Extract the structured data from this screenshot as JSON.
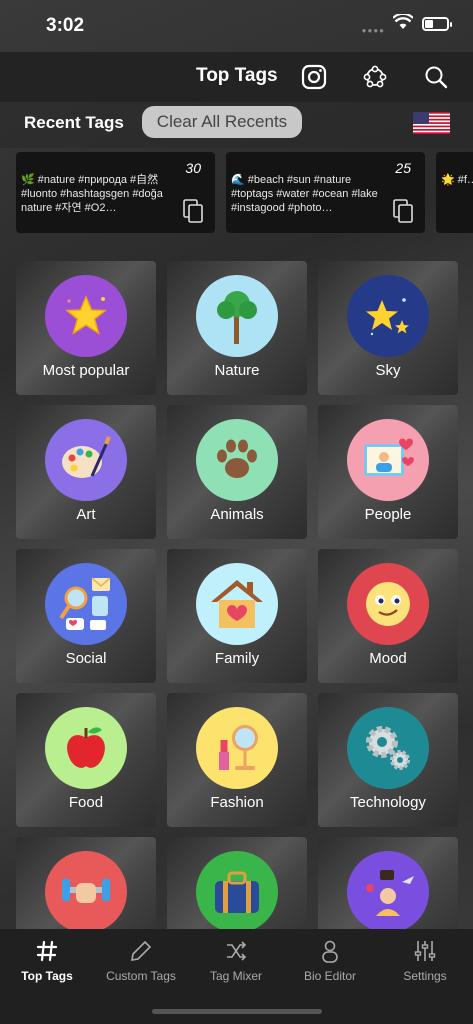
{
  "status": {
    "time": "3:02"
  },
  "header": {
    "title": "Top Tags"
  },
  "recent": {
    "label": "Recent Tags",
    "clear_label": "Clear All Recents",
    "cards": [
      {
        "count": "30",
        "text": "🌿 #nature #природа #自然 #luonto #hashtagsgen #doğa nature #자연 #O2…"
      },
      {
        "count": "25",
        "text": "🌊 #beach #sun #nature #toptags #water #ocean #lake #instagood #photo…"
      },
      {
        "count": "",
        "text": "🌟 #f… #webs… #food…"
      }
    ]
  },
  "categories": [
    {
      "label": "Most popular",
      "color": "#9b4fd6",
      "icon": "star-sparkle-icon"
    },
    {
      "label": "Nature",
      "color": "#aee3f5",
      "icon": "tree-icon"
    },
    {
      "label": "Sky",
      "color": "#263a8a",
      "icon": "stars-night-icon"
    },
    {
      "label": "Art",
      "color": "#8b6fe6",
      "icon": "palette-icon"
    },
    {
      "label": "Animals",
      "color": "#8fe0b4",
      "icon": "paw-icon"
    },
    {
      "label": "People",
      "color": "#f4a0b0",
      "icon": "portrait-heart-icon"
    },
    {
      "label": "Social",
      "color": "#5b74e6",
      "icon": "social-media-icon"
    },
    {
      "label": "Family",
      "color": "#bff0fb",
      "icon": "house-heart-icon"
    },
    {
      "label": "Mood",
      "color": "#e04650",
      "icon": "smiley-face-icon"
    },
    {
      "label": "Food",
      "color": "#b9ef8e",
      "icon": "apple-icon"
    },
    {
      "label": "Fashion",
      "color": "#fbe36e",
      "icon": "mirror-lipstick-icon"
    },
    {
      "label": "Technology",
      "color": "#1e8b94",
      "icon": "gears-icon"
    },
    {
      "label": "",
      "color": "#e85a5a",
      "icon": "dumbbell-icon"
    },
    {
      "label": "",
      "color": "#3ab54a",
      "icon": "suitcase-icon"
    },
    {
      "label": "",
      "color": "#7a4fe0",
      "icon": "travel-person-icon"
    }
  ],
  "tabs": [
    {
      "label": "Top Tags",
      "icon": "hashtag-icon",
      "active": true
    },
    {
      "label": "Custom Tags",
      "icon": "pencil-icon",
      "active": false
    },
    {
      "label": "Tag Mixer",
      "icon": "shuffle-icon",
      "active": false
    },
    {
      "label": "Bio Editor",
      "icon": "person-icon",
      "active": false
    },
    {
      "label": "Settings",
      "icon": "sliders-icon",
      "active": false
    }
  ]
}
